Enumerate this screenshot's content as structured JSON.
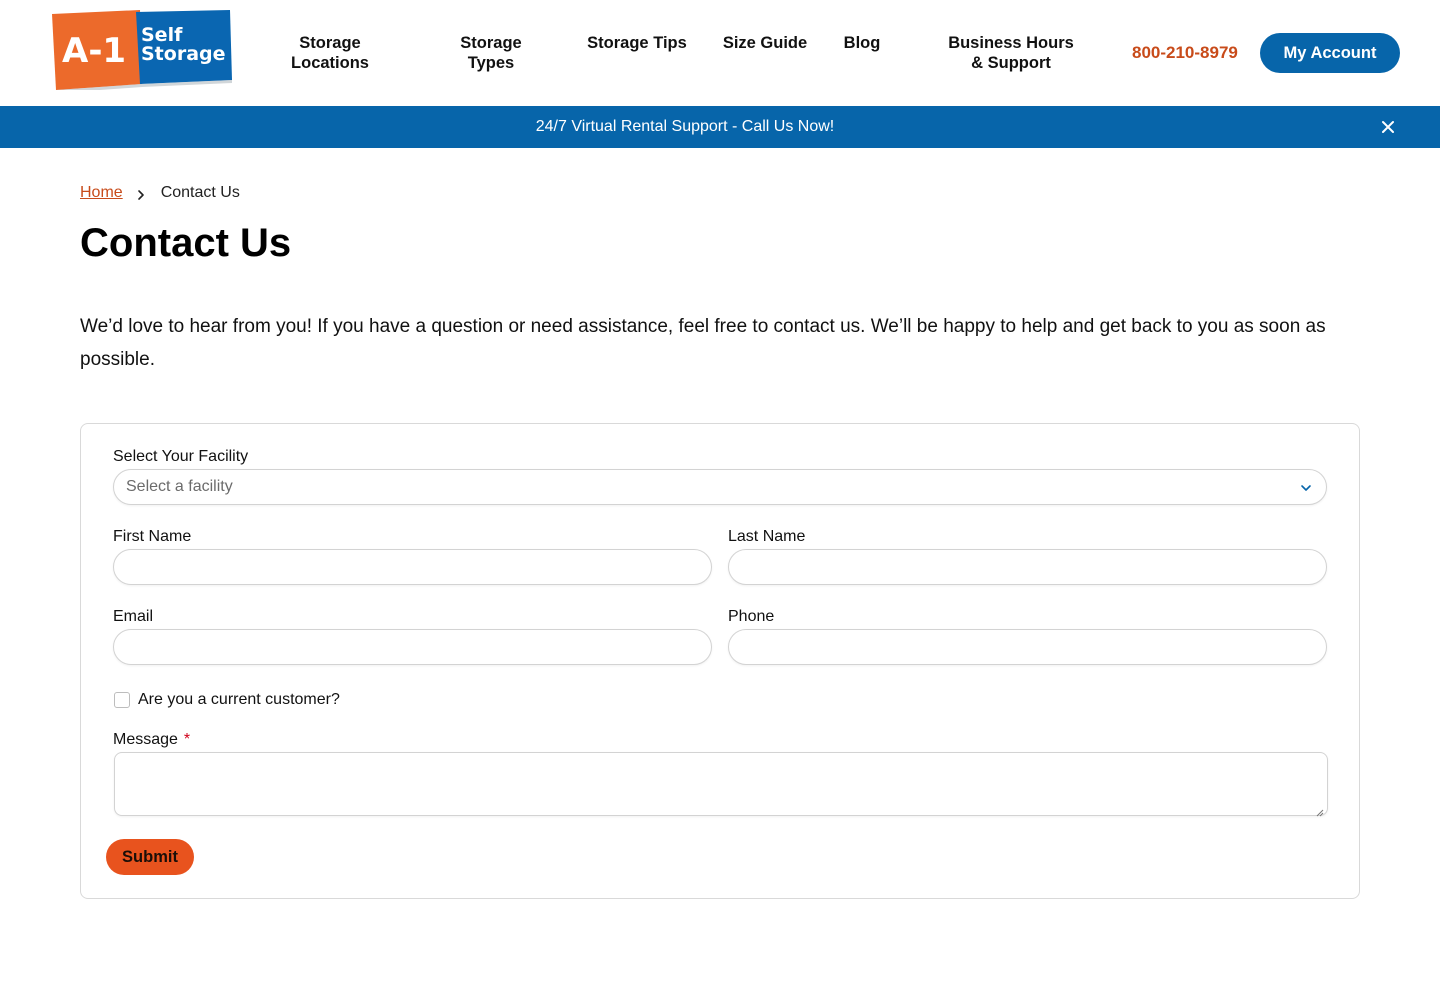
{
  "brand": {
    "logo_left": "A-1",
    "logo_right_top": "Self",
    "logo_right_bottom": "Storage",
    "orange": "#e8531e",
    "blue": "#0765aa"
  },
  "nav": {
    "items": [
      {
        "line1": "Storage",
        "line2": "Locations"
      },
      {
        "line1": "Storage",
        "line2": "Types"
      },
      {
        "line1": "Storage Tips",
        "line2": ""
      },
      {
        "line1": "Size Guide",
        "line2": ""
      },
      {
        "line1": "Blog",
        "line2": ""
      },
      {
        "line1": "Business Hours",
        "line2": "& Support"
      }
    ],
    "phone": "800-210-8979",
    "account": "My Account"
  },
  "banner": {
    "text": "24/7 Virtual Rental Support - Call Us Now!",
    "close_icon": "close-icon"
  },
  "breadcrumb": {
    "home": "Home",
    "current": "Contact Us"
  },
  "page": {
    "title": "Contact Us",
    "intro": "We’d love to hear from you! If you have a question or need assistance, feel free to contact us. We’ll be happy to help and get back to you as soon as possible."
  },
  "form": {
    "facility_label": "Select Your Facility",
    "facility_placeholder": "Select a facility",
    "first_name_label": "First Name",
    "first_name_value": "",
    "last_name_label": "Last Name",
    "last_name_value": "",
    "email_label": "Email",
    "email_value": "",
    "phone_label": "Phone",
    "phone_value": "",
    "customer_checkbox_label": "Are you a current customer?",
    "customer_checked": false,
    "message_label": "Message",
    "message_required_mark": "*",
    "message_value": "",
    "submit_label": "Submit"
  }
}
